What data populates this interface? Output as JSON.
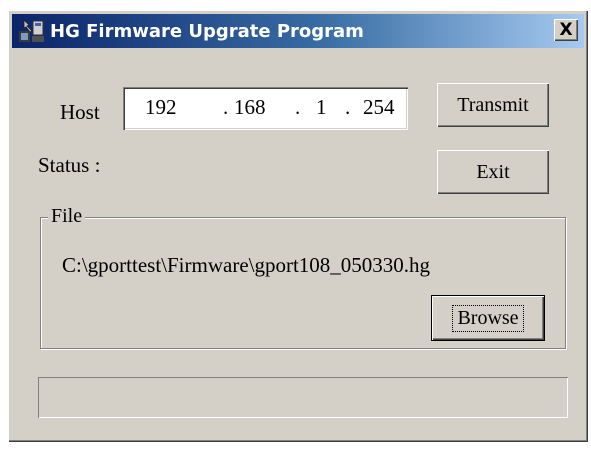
{
  "window": {
    "title": "HG Firmware Upgrate Program",
    "close_glyph": "X"
  },
  "host": {
    "label": "Host",
    "ip": {
      "octet1": "192",
      "octet2": "168",
      "octet3": "1",
      "octet4": "254",
      "dot": "."
    }
  },
  "status": {
    "label": "Status :"
  },
  "buttons": {
    "transmit": "Transmit",
    "exit": "Exit",
    "browse": "Browse"
  },
  "file": {
    "group_label": "File",
    "path": "C:\\gporttest\\Firmware\\gport108_050330.hg"
  },
  "progress": {
    "value": 0
  },
  "icons": {
    "app": "app-icon",
    "close": "close-icon"
  },
  "colors": {
    "titlebar_start": "#0a246a",
    "titlebar_end": "#a6caf0",
    "dialog_bg": "#d4d0c8"
  }
}
